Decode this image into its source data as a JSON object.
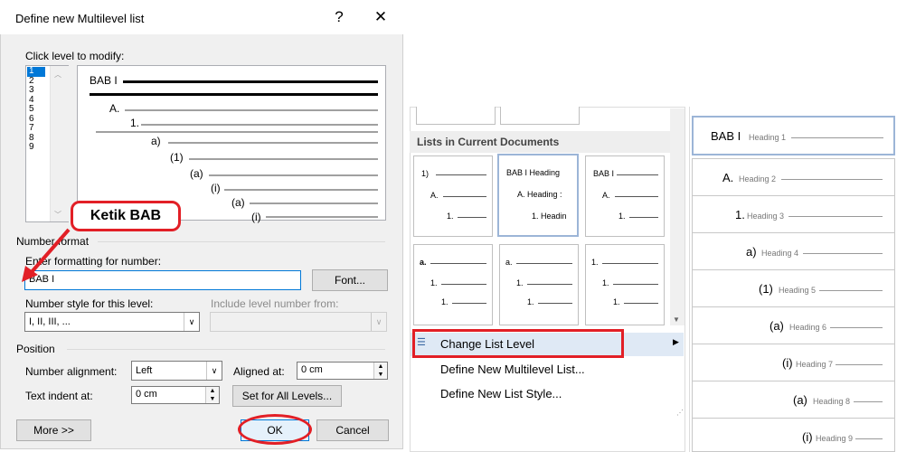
{
  "dialog": {
    "title": "Define new Multilevel list",
    "help_glyph": "?",
    "close_glyph": "✕",
    "click_level_label": "Click level to modify:",
    "levels": [
      "1",
      "2",
      "3",
      "4",
      "5",
      "6",
      "7",
      "8",
      "9"
    ],
    "preview": {
      "labels": [
        "BAB I",
        "A.",
        "1.",
        "a)",
        "(1)",
        "(a)",
        "(i)",
        "(a)",
        "(i)"
      ]
    },
    "number_format": {
      "group_label": "Number format",
      "enter_formatting_label": "Enter formatting for number:",
      "formatting_value": "BAB I",
      "font_button": "Font...",
      "number_style_label": "Number style for this level:",
      "number_style_value": "I, II, III, ...",
      "include_level_label": "Include level number from:"
    },
    "position": {
      "group_label": "Position",
      "number_alignment_label": "Number alignment:",
      "number_alignment_value": "Left",
      "aligned_at_label": "Aligned at:",
      "aligned_at_value": "0 cm",
      "text_indent_label": "Text indent at:",
      "text_indent_value": "0 cm",
      "set_all_button": "Set for All Levels..."
    },
    "buttons": {
      "more": "More >>",
      "ok": "OK",
      "cancel": "Cancel"
    },
    "callout_text": "Ketik BAB"
  },
  "gallery": {
    "section_title": "Lists in Current Documents",
    "row1": [
      {
        "lines": [
          "1)",
          "A.",
          "1."
        ]
      },
      {
        "lines": [
          "BAB I Heading",
          "A. Heading :",
          "1. Headin"
        ]
      },
      {
        "lines": [
          "BAB I",
          "A.",
          "1."
        ]
      }
    ],
    "row2": [
      {
        "lines": [
          "a.",
          "1.",
          "1."
        ]
      },
      {
        "lines": [
          "a.",
          "1.",
          "1."
        ]
      },
      {
        "lines": [
          "1.",
          "1.",
          "1."
        ]
      }
    ],
    "menu": {
      "change_level": "Change List Level",
      "define_multilevel": "Define New Multilevel List...",
      "define_style": "Define New List Style..."
    }
  },
  "levels_panel": [
    {
      "main": "BAB I",
      "sub": "Heading 1"
    },
    {
      "main": "A.",
      "sub": "Heading 2"
    },
    {
      "main": "1.",
      "sub": "Heading 3"
    },
    {
      "main": "a)",
      "sub": "Heading 4"
    },
    {
      "main": "(1)",
      "sub": "Heading 5"
    },
    {
      "main": "(a)",
      "sub": "Heading 6"
    },
    {
      "main": "(i)",
      "sub": "Heading 7"
    },
    {
      "main": "(a)",
      "sub": "Heading 8"
    },
    {
      "main": "(i)",
      "sub": "Heading 9"
    }
  ],
  "colors": {
    "accent": "#0078d7",
    "highlight_red": "#e21f26"
  }
}
